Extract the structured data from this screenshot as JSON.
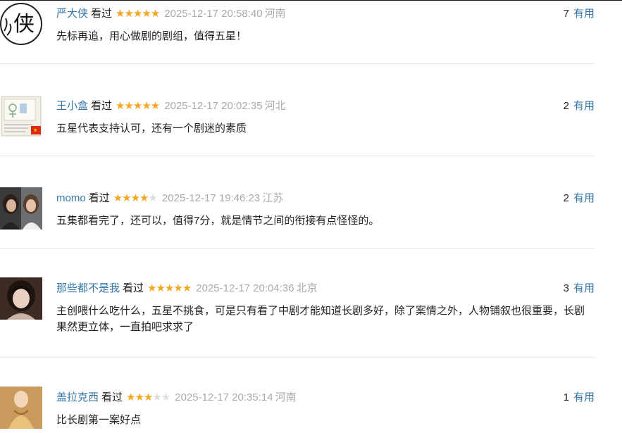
{
  "comments": [
    {
      "user": "严大侠",
      "status": "看过",
      "rating": 5,
      "time": "2025-12-17 20:58:40",
      "location": "河南",
      "votes": "7",
      "useful_label": "有用",
      "text": "先标再追，用心做剧的剧组，值得五星！",
      "avatar_text": "侠"
    },
    {
      "user": "王小盒",
      "status": "看过",
      "rating": 5,
      "time": "2025-12-17 20:02:35",
      "location": "河北",
      "votes": "2",
      "useful_label": "有用",
      "text": "五星代表支持认可，还有一个剧迷的素质"
    },
    {
      "user": "momo",
      "status": "看过",
      "rating": 4,
      "time": "2025-12-17 19:46:23",
      "location": "江苏",
      "votes": "2",
      "useful_label": "有用",
      "text": "五集都看完了，还可以，值得7分，就是情节之间的衔接有点怪怪的。"
    },
    {
      "user": "那些都不是我",
      "status": "看过",
      "rating": 5,
      "time": "2025-12-17 20:04:36",
      "location": "北京",
      "votes": "3",
      "useful_label": "有用",
      "text": "主创喂什么吃什么，五星不挑食，可是只有看了中剧才能知道长剧多好，除了案情之外，人物铺叙也很重要，长剧果然更立体，一直拍吧求求了"
    },
    {
      "user": "盖拉克西",
      "status": "看过",
      "rating": 3,
      "time": "2025-12-17 20:35:14",
      "location": "河南",
      "votes": "1",
      "useful_label": "有用",
      "text": "比长剧第一案好点"
    }
  ],
  "colors": {
    "link": "#3377aa",
    "star": "#f5a623",
    "meta": "#aaaaaa"
  }
}
